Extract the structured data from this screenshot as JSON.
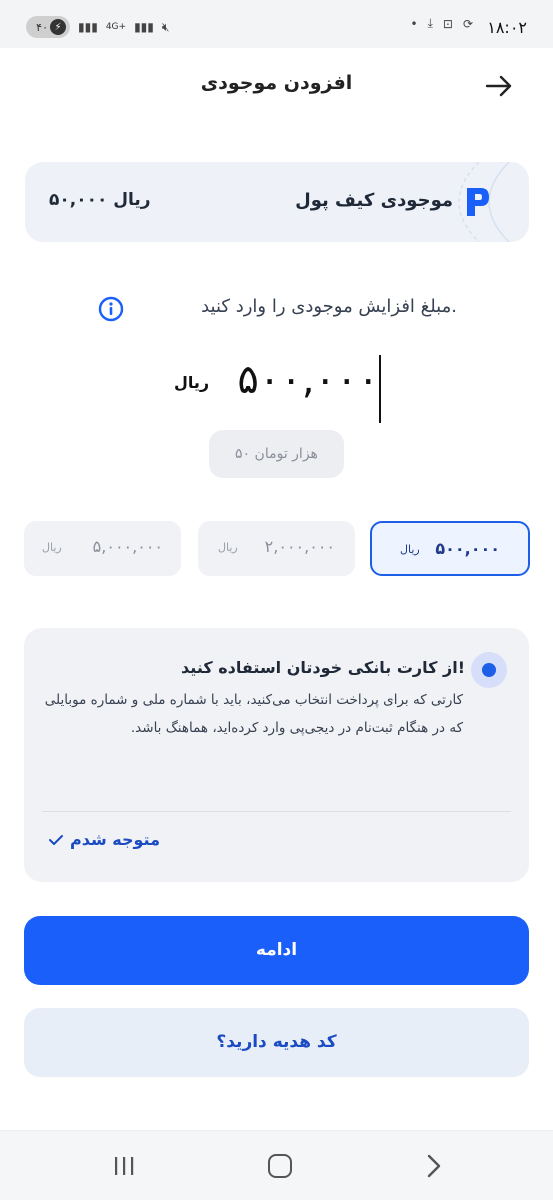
{
  "status_bar": {
    "time": "۱۸:۰۲",
    "battery": "۴۰",
    "network": "4G+"
  },
  "header": {
    "title": "افزودن موجودی"
  },
  "wallet": {
    "label": "موجودی کیف پول",
    "amount": "۵۰,۰۰۰ ریال"
  },
  "amount_input": {
    "prompt": "مبلغ افزایش موجودی را وارد کنید.",
    "value": "۵۰۰,۰۰۰",
    "unit": "ریال",
    "toman_hint": "۵۰ هزار تومان"
  },
  "presets": [
    {
      "value": "۵۰۰,۰۰۰",
      "unit": "ریال",
      "selected": true
    },
    {
      "value": "۲,۰۰۰,۰۰۰",
      "unit": "ریال",
      "selected": false
    },
    {
      "value": "۵,۰۰۰,۰۰۰",
      "unit": "ریال",
      "selected": false
    }
  ],
  "notice": {
    "title": "از کارت بانکی خودتان استفاده کنید!",
    "body": "کارتی که برای پرداخت انتخاب می‌کنید، باید با شماره ملی و شماره موبایلی که در هنگام ثبت‌نام در دیجی‌پی وارد کرده‌اید، هماهنگ باشد.",
    "ack_label": "متوجه شدم"
  },
  "actions": {
    "continue_label": "ادامه",
    "gift_code_label": "کد هدیه دارید؟"
  },
  "colors": {
    "primary": "#1a5ffa",
    "accent_dark": "#1a4bc2",
    "card_bg": "#eef2f8"
  }
}
